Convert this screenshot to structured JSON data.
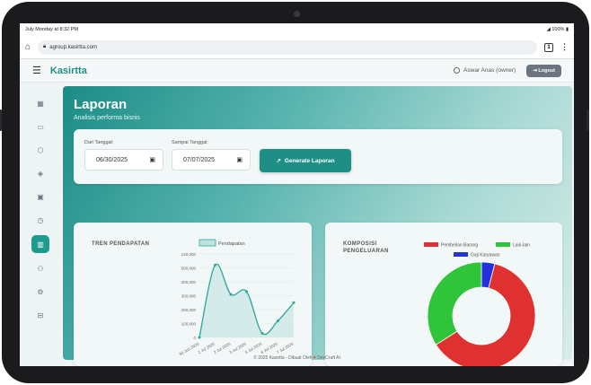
{
  "status_bar": {
    "left": "July Monday at 8:32 PM",
    "right": "100%"
  },
  "browser": {
    "url": "agroup.kasirtta.com",
    "tab_count": "1"
  },
  "app": {
    "brand": "Kasirtta",
    "user": "Aswar Anas (owner)",
    "logout": "Logout"
  },
  "page": {
    "title": "Laporan",
    "subtitle": "Analisis performa bisnis"
  },
  "filters": {
    "from_label": "Dari Tanggal:",
    "from_value": "06/30/2025",
    "to_label": "Sampai Tanggal:",
    "to_value": "07/07/2025",
    "generate": "Generate Laporan"
  },
  "revenue_card": {
    "title_line1": "TREN",
    "title_line2": "PENDAPATAN",
    "legend": "Pendapatan"
  },
  "expense_card": {
    "title_line1": "KOMPOSISI",
    "title_line2": "PENGELUARAN"
  },
  "footer": {
    "prefix": "© 2025 Kasirtta - Dibuat Oleh",
    "suffix": "DevCraft AI"
  },
  "colors": {
    "accent": "#1f8f86",
    "line": "#2aa89c",
    "pie_red": "#e03131",
    "pie_green": "#2fc43a",
    "pie_blue": "#2233dd"
  },
  "chart_data": [
    {
      "type": "line",
      "legend": [
        "Pendapatan"
      ],
      "x": [
        "30 Jun 2025",
        "1 Jul 2025",
        "2 Jul 2025",
        "3 Jul 2025",
        "5 Jul 2025",
        "6 Jul 2025",
        "7 Jul 2025"
      ],
      "y_ticks": [
        "0",
        "100,000",
        "200,000",
        "300,000",
        "400,000",
        "500,000",
        "120,000"
      ],
      "ylim": [
        0,
        600000
      ],
      "series": [
        {
          "name": "Pendapatan",
          "values": [
            0,
            520000,
            310000,
            330000,
            30000,
            120000,
            250000
          ]
        }
      ]
    },
    {
      "type": "pie",
      "legend": [
        "Pembelian Barang",
        "Lain-lain",
        "Gaji Karyawan"
      ],
      "values": [
        62,
        34,
        4
      ],
      "colors": [
        "#e03131",
        "#2fc43a",
        "#2233dd"
      ]
    }
  ]
}
